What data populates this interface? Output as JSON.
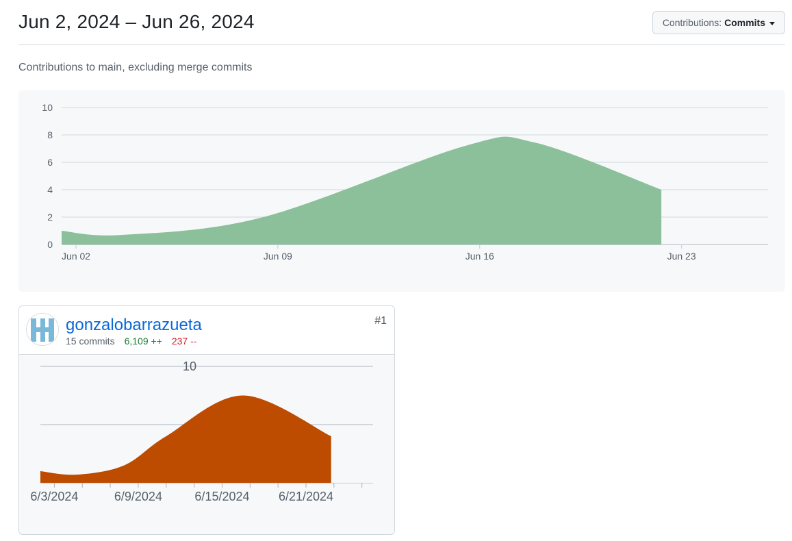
{
  "header": {
    "date_range": "Jun 2, 2024 – Jun 26, 2024",
    "dropdown_prefix": "Contributions:",
    "dropdown_value": "Commits"
  },
  "subtitle": "Contributions to main, excluding merge commits",
  "colors": {
    "main_area": "#8cc09a",
    "contributor_area": "#bd4b00",
    "link": "#0969da",
    "additions": "#1a7f37",
    "deletions": "#cf222e"
  },
  "contributor": {
    "username": "gonzalobarrazueta",
    "commits": "15 commits",
    "additions": "6,109 ++",
    "deletions": "237 --",
    "rank": "#1",
    "avatar_icon": "identicon-avatar"
  },
  "chart_data": [
    {
      "type": "area",
      "y_ticks": [
        "0",
        "2",
        "4",
        "6",
        "8",
        "10"
      ],
      "ylim": [
        0,
        10
      ],
      "x_ticks": [
        "Jun 02",
        "Jun 09",
        "Jun 16",
        "Jun 23"
      ],
      "xlim": [
        0,
        24.5
      ],
      "grid": true,
      "x": [
        0,
        2.1,
        7,
        14,
        16.4,
        20.8
      ],
      "y": [
        1,
        0.7,
        2,
        7.2,
        7.45,
        4
      ]
    },
    {
      "type": "area",
      "y_ticks": [
        "10"
      ],
      "ylim": [
        0,
        10
      ],
      "x_ticks": [
        "6/3/2024",
        "6/9/2024",
        "6/15/2024",
        "6/21/2024"
      ],
      "xlim": [
        0,
        23.8
      ],
      "grid": true,
      "x": [
        0,
        2.6,
        6,
        9,
        14.5,
        20.8
      ],
      "y": [
        1,
        0.7,
        1.5,
        4,
        7.5,
        4
      ]
    }
  ]
}
